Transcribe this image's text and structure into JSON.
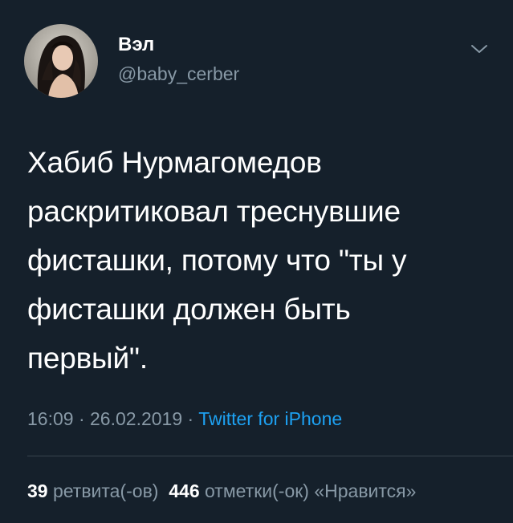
{
  "tweet": {
    "author": {
      "display_name": "Вэл",
      "handle": "@baby_cerber",
      "avatar_icon": "avatar-photo"
    },
    "menu_icon": "chevron-down-icon",
    "text": "Хабиб Нурмагомедов\nраскритиковал треснувшие\nфисташки, потому что \"ты у\nфисташки должен быть\nпервый\".",
    "time": "16:09",
    "separator": "·",
    "date": "26.02.2019",
    "source": "Twitter for iPhone",
    "stats": {
      "retweets_count": "39",
      "retweets_label": "ретвита(-ов)",
      "likes_count": "446",
      "likes_label": "отметки(-ок) «Нравится»"
    }
  },
  "colors": {
    "background": "#15202b",
    "text_primary": "#ffffff",
    "text_secondary": "#8899a6",
    "link": "#1da1f2",
    "divider": "#38444d"
  }
}
